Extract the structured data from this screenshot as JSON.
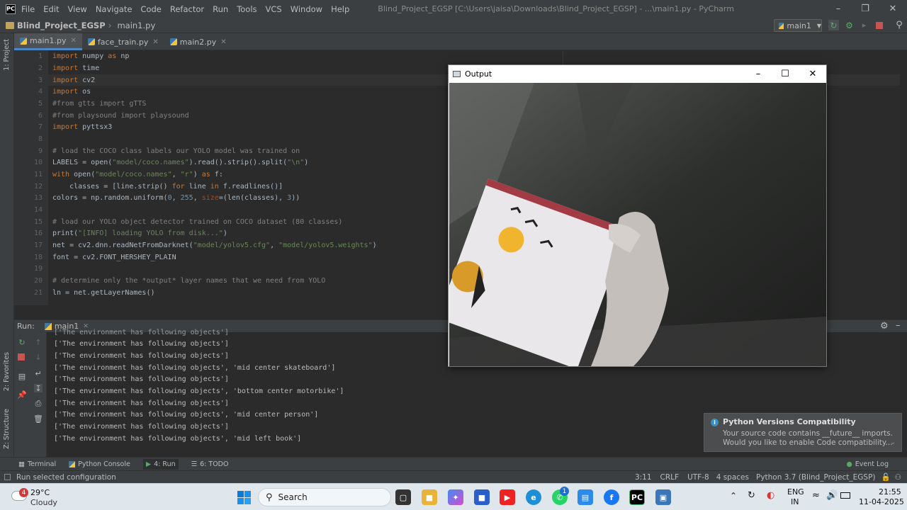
{
  "titlebar": {
    "menus": [
      "File",
      "Edit",
      "View",
      "Navigate",
      "Code",
      "Refactor",
      "Run",
      "Tools",
      "VCS",
      "Window",
      "Help"
    ],
    "window_title": "Blind_Project_EGSP [C:\\Users\\jaisa\\Downloads\\Blind_Project_EGSP] - ...\\main1.py - PyCharm"
  },
  "navbar": {
    "project": "Blind_Project_EGSP",
    "file": "main1.py",
    "run_config": "main1"
  },
  "left_strip": {
    "project_label": "1: Project",
    "favorites_label": "2: Favorites",
    "structure_label": "Z: Structure"
  },
  "tabs": [
    {
      "label": "main1.py",
      "active": true
    },
    {
      "label": "face_train.py",
      "active": false
    },
    {
      "label": "main2.py",
      "active": false
    }
  ],
  "editor": {
    "line_numbers": [
      "1",
      "2",
      "3",
      "4",
      "5",
      "6",
      "7",
      "8",
      "9",
      "10",
      "11",
      "12",
      "13",
      "14",
      "15",
      "16",
      "17",
      "18",
      "19",
      "20",
      "21"
    ]
  },
  "output_window": {
    "title": "Output"
  },
  "run_panel": {
    "label": "Run:",
    "tab": "main1",
    "output_lines": [
      "['The environment has following objects']",
      "['The environment has following objects']",
      "['The environment has following objects']",
      "['The environment has following objects', 'mid center skateboard']",
      "['The environment has following objects']",
      "['The environment has following objects', 'bottom center motorbike']",
      "['The environment has following objects']",
      "['The environment has following objects', 'mid center person']",
      "['The environment has following objects']",
      "['The environment has following objects', 'mid left book']"
    ]
  },
  "notification": {
    "title": "Python Versions Compatibility",
    "line1": "Your source code contains __future__ imports.",
    "line2": "Would you like to enable Code compatibility..."
  },
  "bottom_tools": {
    "terminal": "Terminal",
    "python_console": "Python Console",
    "run": "4: Run",
    "todo": "6: TODO",
    "event_log": "Event Log"
  },
  "status_bar": {
    "message": "Run selected configuration",
    "position": "3:11",
    "line_sep": "CRLF",
    "encoding": "UTF-8",
    "indent": "4 spaces",
    "interpreter": "Python 3.7 (Blind_Project_EGSP)"
  },
  "taskbar": {
    "weather_badge": "4",
    "temperature": "29°C",
    "weather": "Cloudy",
    "search": "Search",
    "lang1": "ENG",
    "lang2": "IN",
    "time": "21:55",
    "date": "11-04-2025",
    "whatsapp_badge": "1"
  },
  "colors": {
    "accent": "#4a88c7",
    "editor_bg": "#2b2b2b",
    "panel_bg": "#3c3f41",
    "keyword": "#cc7832",
    "string": "#6a8759",
    "comment": "#808080"
  }
}
